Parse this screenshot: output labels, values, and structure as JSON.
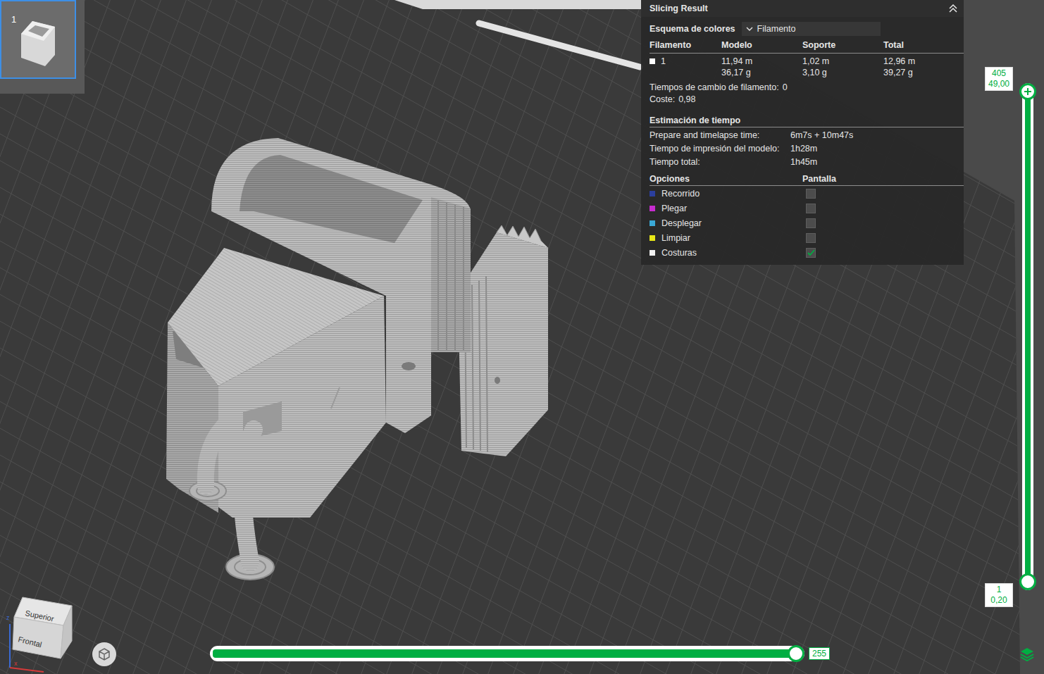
{
  "plate": {
    "number": "1",
    "selected": true
  },
  "slicing_result": {
    "title": "Slicing Result",
    "expanded": true,
    "color_scheme": {
      "label": "Esquema de colores",
      "value": "Filamento"
    },
    "columns": [
      "Filamento",
      "Modelo",
      "Soporte",
      "Total"
    ],
    "rows": [
      {
        "filament": "1",
        "color": "#ffffff",
        "model": [
          "11,94 m",
          "36,17 g"
        ],
        "support": [
          "1,02 m",
          "3,10 g"
        ],
        "total": [
          "12,96 m",
          "39,27 g"
        ]
      }
    ],
    "filament_changes": {
      "label": "Tiempos de cambio de filamento:",
      "value": "0"
    },
    "cost": {
      "label": "Coste:",
      "value": "0,98"
    },
    "time_title": "Estimación de tiempo",
    "times": [
      {
        "label": "Prepare and timelapse time:",
        "value": "6m7s + 10m47s"
      },
      {
        "label": "Tiempo de impresión del modelo:",
        "value": "1h28m"
      },
      {
        "label": "Tiempo total:",
        "value": "1h45m"
      }
    ],
    "options_title": "Opciones",
    "display_title": "Pantalla",
    "options": [
      {
        "label": "Recorrido",
        "color": "#2b3f9e",
        "checked": false
      },
      {
        "label": "Plegar",
        "color": "#c62ccf",
        "checked": false
      },
      {
        "label": "Desplegar",
        "color": "#3aa8d6",
        "checked": false
      },
      {
        "label": "Limpiar",
        "color": "#e6e617",
        "checked": false
      },
      {
        "label": "Costuras",
        "color": "#f0f0f0",
        "checked": true
      }
    ]
  },
  "layer_slider": {
    "upper": {
      "layer": "405",
      "height": "49,00",
      "level": 1
    },
    "lower": {
      "layer": "1",
      "height": "0,20",
      "level": 0
    }
  },
  "move_slider": {
    "value": "255",
    "level": 1
  },
  "view_cube": {
    "top": "Superior",
    "front": "Frontal",
    "axis_z": "z",
    "axis_x": "x"
  }
}
